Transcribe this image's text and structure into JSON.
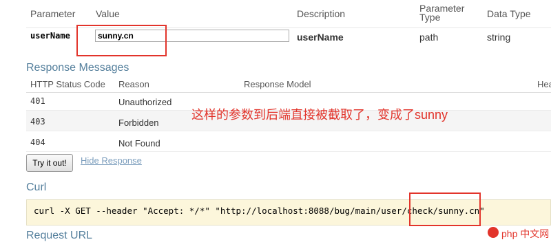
{
  "params": {
    "headers": {
      "parameter": "Parameter",
      "value": "Value",
      "description": "Description",
      "param_type": "Parameter\nType",
      "data_type": "Data Type"
    },
    "row": {
      "name": "userName",
      "value": "sunny.cn",
      "description": "userName",
      "param_type": "path",
      "data_type": "string"
    }
  },
  "response": {
    "title": "Response Messages",
    "headers": {
      "code": "HTTP Status Code",
      "reason": "Reason",
      "model": "Response Model",
      "headers": "Hea"
    },
    "rows": [
      {
        "code": "401",
        "reason": "Unauthorized"
      },
      {
        "code": "403",
        "reason": "Forbidden"
      },
      {
        "code": "404",
        "reason": "Not Found"
      }
    ]
  },
  "actions": {
    "try_label": "Try it out!",
    "hide_label": "Hide Response"
  },
  "curl": {
    "title": "Curl",
    "command": "curl -X GET --header \"Accept: */*\" \"http://localhost:8088/bug/main/user/check/sunny.cn\""
  },
  "request_url": {
    "title": "Request URL"
  },
  "annotation": "这样的参数到后端直接被截取了，变成了sunny",
  "watermark": "php 中文网"
}
